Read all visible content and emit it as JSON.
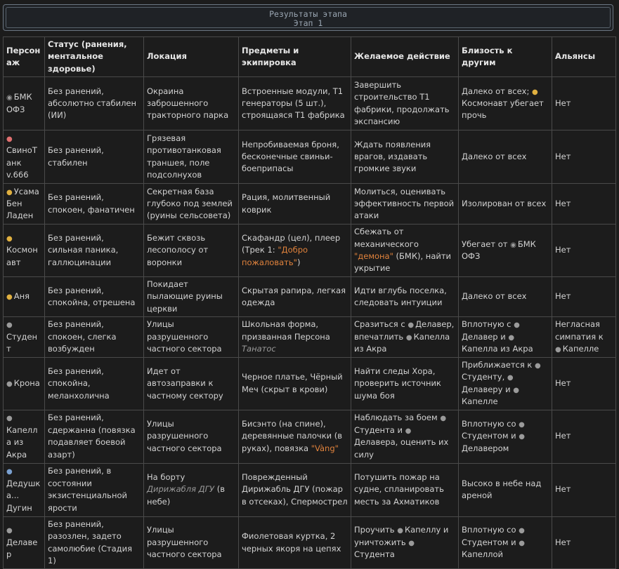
{
  "header": {
    "title": "Результаты этапа",
    "subtitle": "Этап 1"
  },
  "columns": [
    "Персонаж",
    "Статус (ранения, ментальное здоровье)",
    "Локация",
    "Предметы и экипировка",
    "Желаемое действие",
    "Близость к другим",
    "Альянсы"
  ],
  "rows": [
    {
      "icon": "robot-icon",
      "name": "БМК ОФЗ",
      "status": "Без ранений, абсолютно стабилен (ИИ)",
      "location": "Окраина заброшенного тракторного парка",
      "items": "Встроенные модули, Т1 генераторы (5 шт.), строящаяся Т1 фабрика",
      "action": "Завершить строительство Т1 фабрики, продолжать экспансию",
      "proximity": "Далеко от всех; Космонавт убегает прочь",
      "alliances": "Нет"
    },
    {
      "icon": "pig-icon",
      "name": "СвиноТанк v.666",
      "status": "Без ранений, стабилен",
      "location": "Грязевая противотанковая траншея, поле подсолнухов",
      "items": "Непробиваемая броня, бесконечные свиньи-боеприпасы",
      "action": "Ждать появления врагов, издавать громкие звуки",
      "proximity": "Далеко от всех",
      "alliances": "Нет"
    },
    {
      "icon": "person-icon",
      "name": "Усама Бен Ладен",
      "status": "Без ранений, спокоен, фанатичен",
      "location": "Секретная база глубоко под землей (руины сельсовета)",
      "items": "Рация, молитвенный коврик",
      "action": "Молиться, оценивать эффективность первой атаки",
      "proximity": "Изолирован от всех",
      "alliances": "Нет"
    },
    {
      "icon": "astronaut-icon",
      "name": "Космонавт",
      "status": "Без ранений, сильная паника, галлюцинации",
      "location": "Бежит сквозь лесополосу от воронки",
      "items_pre": "Скафандр (цел), плеер (Трек 1: ",
      "items_quote": "\"Добро пожаловать\"",
      "items_post": ")",
      "action_pre": "Сбежать от механического ",
      "action_quote": "\"демона\"",
      "action_post": " (БМК), найти укрытие",
      "proximity": "Убегает от БМК ОФЗ",
      "alliances": "Нет"
    },
    {
      "icon": "girl-icon",
      "name": "Аня",
      "status": "Без ранений, спокойна, отрешена",
      "location": "Покидает пылающие руины церкви",
      "items": "Скрытая рапира, легкая одежда",
      "action": "Идти вглубь поселка, следовать интуиции",
      "proximity": "Далеко от всех",
      "alliances": "Нет"
    },
    {
      "icon": "user-icon",
      "name": "Студент",
      "status": "Без ранений, спокоен, слегка возбужден",
      "location": "Улицы разрушенного частного сектора",
      "items_pre": "Школьная форма, призванная Персона ",
      "items_italic": "Танатос",
      "action": "Сразиться с Делавер, впечатлить Капелла из Акра",
      "proximity": "Вплотную с Делавер и Капелла из Акра",
      "alliances": "Негласная симпатия к Капелле"
    },
    {
      "icon": "user-icon",
      "name": "Крона",
      "status": "Без ранений, спокойна, меланхолична",
      "location": "Идет от автозаправки к частному сектору",
      "items": "Черное платье, Чёрный Меч (скрыт в крови)",
      "action": "Найти следы Хора, проверить источник шума боя",
      "proximity": "Приближается к Студенту, Делаверу и Капелле",
      "alliances": "Нет"
    },
    {
      "icon": "user-icon",
      "name": "Капелла из Акра",
      "status": "Без ранений, сдержанна (повязка подавляет боевой азарт)",
      "location": "Улицы разрушенного частного сектора",
      "items_pre": "Бисэнто (на спине), деревянные палочки (в руках), повязка ",
      "items_quote": "\"Vàng\"",
      "action": "Наблюдать за боем Студента и Делавера, оценить их силу",
      "proximity": "Вплотную со Студентом и Делавером",
      "alliances": "Нет"
    },
    {
      "icon": "old-man-icon",
      "name": "Дедушка... Дугин",
      "status": "Без ранений, в состоянии экзистенциальной ярости",
      "location_pre": "На борту ",
      "location_italic": "Дирижабля ДГУ",
      "location_post": " (в небе)",
      "items": "Поврежденный Дирижабль ДГУ (пожар в отсеках), Спермострел",
      "action": "Потушить пожар на судне, спланировать месть за Ахматиков",
      "proximity": "Высоко в небе над ареной",
      "alliances": "Нет"
    },
    {
      "icon": "user-icon",
      "name": "Делавер",
      "status": "Без ранений, разозлен, задето самолюбие (Стадия 1)",
      "location": "Улицы разрушенного частного сектора",
      "items": "Фиолетовая куртка, 2 черных якоря на цепях",
      "action": "Проучить Капеллу и уничтожить Студента",
      "proximity": "Вплотную со Студентом и Капеллой",
      "alliances": "Нет"
    }
  ]
}
